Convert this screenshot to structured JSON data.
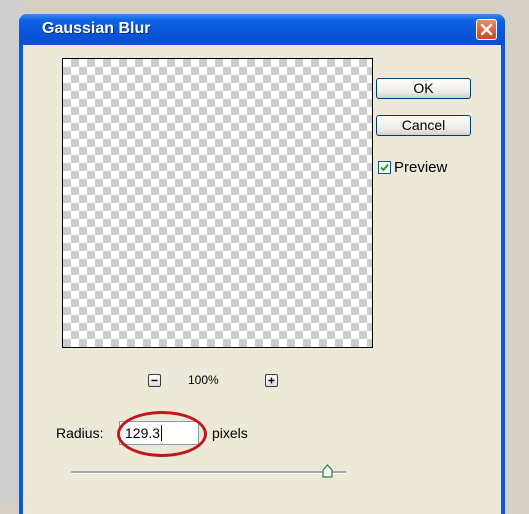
{
  "dialog": {
    "title": "Gaussian Blur",
    "ok_label": "OK",
    "cancel_label": "Cancel",
    "preview_label": "Preview",
    "preview_checked": true,
    "zoom_level": "100%",
    "radius_label": "Radius:",
    "radius_value": "129.3",
    "radius_unit": "pixels",
    "radius_slider_fraction": 0.93
  },
  "colors": {
    "title_bar": "#0a55d8",
    "dialog_bg": "#ece9d8",
    "highlight": "#c0181a"
  }
}
